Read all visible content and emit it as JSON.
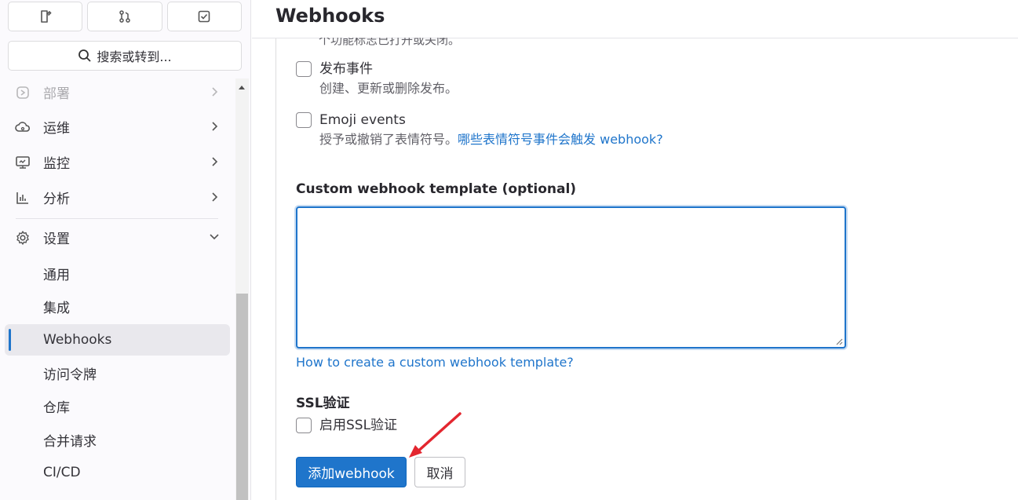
{
  "sidebar": {
    "search_label": "搜索或转到...",
    "items": [
      {
        "label": "部署",
        "icon": "deploy-icon"
      },
      {
        "label": "运维",
        "icon": "cloud-ops-icon"
      },
      {
        "label": "监控",
        "icon": "monitor-icon"
      },
      {
        "label": "分析",
        "icon": "chart-icon"
      },
      {
        "label": "设置",
        "icon": "gear-icon"
      }
    ],
    "sub_items": [
      {
        "label": "通用"
      },
      {
        "label": "集成"
      },
      {
        "label": "Webhooks"
      },
      {
        "label": "访问令牌"
      },
      {
        "label": "仓库"
      },
      {
        "label": "合并请求"
      },
      {
        "label": "CI/CD"
      }
    ]
  },
  "main": {
    "title": "Webhooks",
    "clipped_text": "个功能标志已打开或关闭。",
    "events": [
      {
        "label": "发布事件",
        "help": "创建、更新或删除发布。"
      },
      {
        "label": "Emoji events",
        "help": "授予或撤销了表情符号。",
        "help_link": "哪些表情符号事件会触发 webhook",
        "help_suffix": "?"
      }
    ],
    "template_label": "Custom webhook template (optional)",
    "template_value": "",
    "template_help_link": "How to create a custom webhook template?",
    "ssl_title": "SSL验证",
    "ssl_checkbox_label": "启用SSL验证",
    "submit_label": "添加webhook",
    "cancel_label": "取消"
  },
  "colors": {
    "accent": "#1f75cb",
    "annotation_arrow": "#e3262f"
  }
}
